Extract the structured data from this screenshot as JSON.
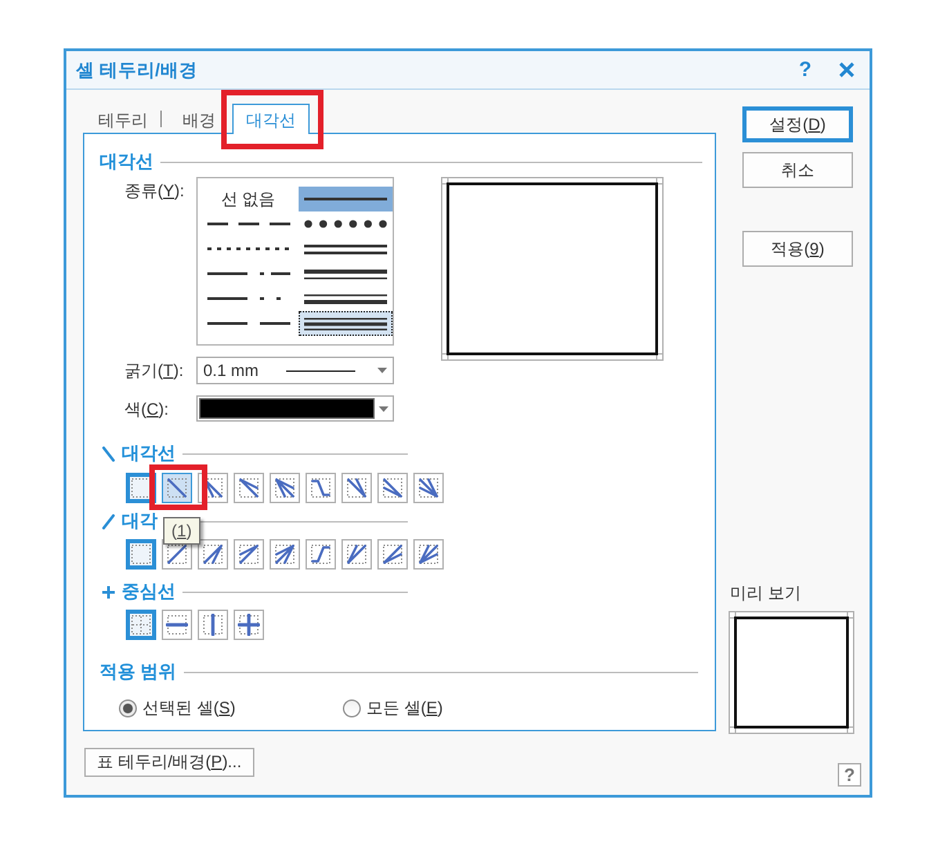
{
  "dialog": {
    "title": "셀 테두리/배경",
    "help": "?"
  },
  "tabs": [
    {
      "label": "테두리",
      "selected": false,
      "highlighted": false
    },
    {
      "label": "배경",
      "selected": false,
      "highlighted": false
    },
    {
      "label": "대각선",
      "selected": true,
      "highlighted": true
    }
  ],
  "panel": {
    "title": "대각선",
    "line_type": {
      "label": [
        "종류(",
        "Y",
        "):"
      ],
      "options": [
        {
          "kind": "none",
          "text": "선 없음",
          "selected": false,
          "focused": false
        },
        {
          "kind": "solid",
          "selected": true,
          "focused": false
        },
        {
          "kind": "dash",
          "selected": false,
          "focused": false
        },
        {
          "kind": "round_dot",
          "selected": false,
          "focused": false
        },
        {
          "kind": "dot",
          "selected": false,
          "focused": false
        },
        {
          "kind": "double",
          "selected": false,
          "focused": false
        },
        {
          "kind": "dash_dot",
          "selected": false,
          "focused": false
        },
        {
          "kind": "thick_thin",
          "selected": false,
          "focused": false
        },
        {
          "kind": "dash_dot_dot",
          "selected": false,
          "focused": false
        },
        {
          "kind": "thin_thick",
          "selected": false,
          "focused": false
        },
        {
          "kind": "long_dash",
          "selected": false,
          "focused": false
        },
        {
          "kind": "triple",
          "selected": false,
          "focused": true
        }
      ]
    },
    "thickness": {
      "label": [
        "굵기(",
        "T",
        "):"
      ],
      "value": "0.1 mm"
    },
    "color": {
      "label": [
        "색(",
        "C",
        "):"
      ],
      "color": "#000000"
    },
    "groups": [
      {
        "kind": "down",
        "title": "대각선",
        "buttons": [
          {
            "kind": "none",
            "selected": true,
            "hovered": false,
            "highlighted": false
          },
          {
            "kind": "single",
            "selected": false,
            "hovered": true,
            "highlighted": true,
            "tooltip": [
              "(",
              "1",
              ")"
            ]
          },
          {
            "kind": "fan_down",
            "selected": false,
            "hovered": false,
            "highlighted": false
          },
          {
            "kind": "fan_right",
            "selected": false,
            "hovered": false,
            "highlighted": false
          },
          {
            "kind": "fan_both",
            "selected": false,
            "hovered": false,
            "highlighted": false
          },
          {
            "kind": "step",
            "selected": false,
            "hovered": false,
            "highlighted": false
          },
          {
            "kind": "converge_top",
            "selected": false,
            "hovered": false,
            "highlighted": false
          },
          {
            "kind": "converge_left",
            "selected": false,
            "hovered": false,
            "highlighted": false
          },
          {
            "kind": "converge_both",
            "selected": false,
            "hovered": false,
            "highlighted": false
          }
        ]
      },
      {
        "kind": "up",
        "title": "대각",
        "buttons": [
          {
            "kind": "none",
            "selected": true,
            "hovered": false,
            "highlighted": false
          },
          {
            "kind": "single",
            "selected": false,
            "hovered": false,
            "highlighted": false
          },
          {
            "kind": "fan_down",
            "selected": false,
            "hovered": false,
            "highlighted": false
          },
          {
            "kind": "fan_right",
            "selected": false,
            "hovered": false,
            "highlighted": false
          },
          {
            "kind": "fan_both",
            "selected": false,
            "hovered": false,
            "highlighted": false
          },
          {
            "kind": "step",
            "selected": false,
            "hovered": false,
            "highlighted": false
          },
          {
            "kind": "converge_top",
            "selected": false,
            "hovered": false,
            "highlighted": false
          },
          {
            "kind": "converge_left",
            "selected": false,
            "hovered": false,
            "highlighted": false
          },
          {
            "kind": "converge_both",
            "selected": false,
            "hovered": false,
            "highlighted": false
          }
        ]
      },
      {
        "kind": "center",
        "title": "중심선",
        "buttons": [
          {
            "kind": "none",
            "selected": true,
            "hovered": false,
            "highlighted": false
          },
          {
            "kind": "horizontal",
            "selected": false,
            "hovered": false,
            "highlighted": false
          },
          {
            "kind": "vertical",
            "selected": false,
            "hovered": false,
            "highlighted": false
          },
          {
            "kind": "cross",
            "selected": false,
            "hovered": false,
            "highlighted": false
          }
        ]
      }
    ],
    "scope": {
      "title": "적용 범위",
      "options": [
        {
          "label": [
            "선택된 셀(",
            "S",
            ")"
          ],
          "selected": true
        },
        {
          "label": [
            "모든 셀(",
            "E",
            ")"
          ],
          "selected": false
        }
      ]
    }
  },
  "actions": [
    {
      "label": [
        "설정(",
        "D",
        ")"
      ],
      "default": true
    },
    {
      "label": [
        "취소"
      ],
      "default": false
    },
    {
      "label": [
        "적용(",
        "9",
        ")"
      ],
      "default": false
    }
  ],
  "preview": {
    "label": "미리 보기"
  },
  "footer": {
    "table_button": [
      "표 테두리/배경(",
      "P",
      ")..."
    ],
    "help": "?"
  }
}
